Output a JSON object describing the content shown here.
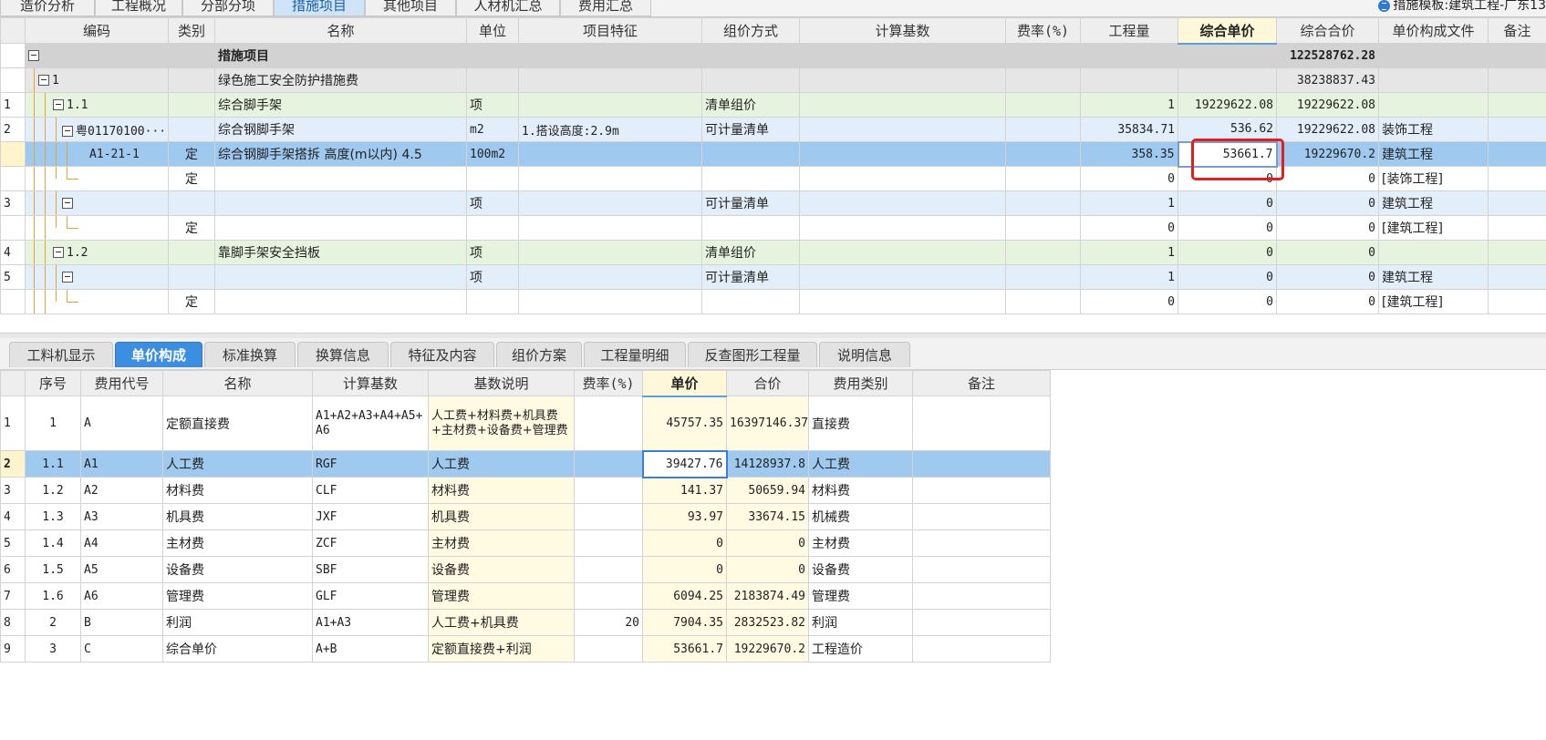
{
  "top_tabs": [
    {
      "label": "造价分析"
    },
    {
      "label": "工程概况"
    },
    {
      "label": "分部分项"
    },
    {
      "label": "措施项目"
    },
    {
      "label": "其他项目"
    },
    {
      "label": "人材机汇总"
    },
    {
      "label": "费用汇总"
    }
  ],
  "template_label": "措施模板:建筑工程-广东13",
  "upper_headers": [
    "",
    "编码",
    "类别",
    "名称",
    "单位",
    "项目特征",
    "组价方式",
    "计算基数",
    "费率(%)",
    "工程量",
    "综合单价",
    "综合合价",
    "单价构成文件",
    "备注"
  ],
  "upper_rows": [
    {
      "rownum": "",
      "code": "",
      "type": "",
      "name": "措施项目",
      "unit": "",
      "feature": "",
      "method": "",
      "base": "",
      "rate": "",
      "qty": "",
      "price": "",
      "total": "122528762.28",
      "file": "",
      "note": ""
    },
    {
      "rownum": "",
      "code": "1",
      "type": "",
      "name": "绿色施工安全防护措施费",
      "unit": "",
      "feature": "",
      "method": "",
      "base": "",
      "rate": "",
      "qty": "",
      "price": "",
      "total": "38238837.43",
      "file": "",
      "note": ""
    },
    {
      "rownum": "1",
      "code": "1.1",
      "type": "",
      "name": "综合脚手架",
      "unit": "项",
      "feature": "",
      "method": "清单组价",
      "base": "",
      "rate": "",
      "qty": "1",
      "price": "19229622.08",
      "total": "19229622.08",
      "file": "",
      "note": ""
    },
    {
      "rownum": "2",
      "code": "粤01170100···",
      "type": "",
      "name": "综合钢脚手架",
      "unit": "m2",
      "feature": "1.搭设高度:2.9m",
      "method": "可计量清单",
      "base": "",
      "rate": "",
      "qty": "35834.71",
      "price": "536.62",
      "total": "19229622.08",
      "file": "装饰工程",
      "note": ""
    },
    {
      "rownum": "",
      "code": "A1-21-1",
      "type": "定",
      "name": "综合钢脚手架搭拆 高度(m以内) 4.5",
      "unit": "100m2",
      "feature": "",
      "method": "",
      "base": "",
      "rate": "",
      "qty": "358.35",
      "price": "53661.7",
      "total": "19229670.2",
      "file": "建筑工程",
      "note": ""
    },
    {
      "rownum": "",
      "code": "",
      "type": "定",
      "name": "",
      "unit": "",
      "feature": "",
      "method": "",
      "base": "",
      "rate": "",
      "qty": "0",
      "price": "0",
      "total": "0",
      "file": "[装饰工程]",
      "note": ""
    },
    {
      "rownum": "3",
      "code": "",
      "type": "",
      "name": "",
      "unit": "项",
      "feature": "",
      "method": "可计量清单",
      "base": "",
      "rate": "",
      "qty": "1",
      "price": "0",
      "total": "0",
      "file": "建筑工程",
      "note": ""
    },
    {
      "rownum": "",
      "code": "",
      "type": "定",
      "name": "",
      "unit": "",
      "feature": "",
      "method": "",
      "base": "",
      "rate": "",
      "qty": "0",
      "price": "0",
      "total": "0",
      "file": "[建筑工程]",
      "note": ""
    },
    {
      "rownum": "4",
      "code": "1.2",
      "type": "",
      "name": "靠脚手架安全挡板",
      "unit": "项",
      "feature": "",
      "method": "清单组价",
      "base": "",
      "rate": "",
      "qty": "1",
      "price": "0",
      "total": "0",
      "file": "",
      "note": ""
    },
    {
      "rownum": "5",
      "code": "",
      "type": "",
      "name": "",
      "unit": "项",
      "feature": "",
      "method": "可计量清单",
      "base": "",
      "rate": "",
      "qty": "1",
      "price": "0",
      "total": "0",
      "file": "建筑工程",
      "note": ""
    },
    {
      "rownum": "",
      "code": "",
      "type": "定",
      "name": "",
      "unit": "",
      "feature": "",
      "method": "",
      "base": "",
      "rate": "",
      "qty": "0",
      "price": "0",
      "total": "0",
      "file": "[建筑工程]",
      "note": ""
    }
  ],
  "bottom_tabs": [
    {
      "label": "工料机显示"
    },
    {
      "label": "单价构成"
    },
    {
      "label": "标准换算"
    },
    {
      "label": "换算信息"
    },
    {
      "label": "特征及内容"
    },
    {
      "label": "组价方案"
    },
    {
      "label": "工程量明细"
    },
    {
      "label": "反查图形工程量"
    },
    {
      "label": "说明信息"
    }
  ],
  "lower_headers": [
    "",
    "序号",
    "费用代号",
    "名称",
    "计算基数",
    "基数说明",
    "费率(%)",
    "单价",
    "合价",
    "费用类别",
    "备注"
  ],
  "lower_rows": [
    {
      "rownum": "1",
      "seq": "1",
      "code": "A",
      "name": "定额直接费",
      "base": "A1+A2+A3+A4+A5+A6",
      "desc": "人工费+材料费+机具费+主材费+设备费+管理费",
      "rate": "",
      "price": "45757.35",
      "total": "16397146.37",
      "cat": "直接费",
      "note": ""
    },
    {
      "rownum": "2",
      "seq": "1.1",
      "code": "A1",
      "name": "人工费",
      "base": "RGF",
      "desc": "人工费",
      "rate": "",
      "price": "39427.76",
      "total": "14128937.8",
      "cat": "人工费",
      "note": ""
    },
    {
      "rownum": "3",
      "seq": "1.2",
      "code": "A2",
      "name": "材料费",
      "base": "CLF",
      "desc": "材料费",
      "rate": "",
      "price": "141.37",
      "total": "50659.94",
      "cat": "材料费",
      "note": ""
    },
    {
      "rownum": "4",
      "seq": "1.3",
      "code": "A3",
      "name": "机具费",
      "base": "JXF",
      "desc": "机具费",
      "rate": "",
      "price": "93.97",
      "total": "33674.15",
      "cat": "机械费",
      "note": ""
    },
    {
      "rownum": "5",
      "seq": "1.4",
      "code": "A4",
      "name": "主材费",
      "base": "ZCF",
      "desc": "主材费",
      "rate": "",
      "price": "0",
      "total": "0",
      "cat": "主材费",
      "note": ""
    },
    {
      "rownum": "6",
      "seq": "1.5",
      "code": "A5",
      "name": "设备费",
      "base": "SBF",
      "desc": "设备费",
      "rate": "",
      "price": "0",
      "total": "0",
      "cat": "设备费",
      "note": ""
    },
    {
      "rownum": "7",
      "seq": "1.6",
      "code": "A6",
      "name": "管理费",
      "base": "GLF",
      "desc": "管理费",
      "rate": "",
      "price": "6094.25",
      "total": "2183874.49",
      "cat": "管理费",
      "note": ""
    },
    {
      "rownum": "8",
      "seq": "2",
      "code": "B",
      "name": "利润",
      "base": "A1+A3",
      "desc": "人工费+机具费",
      "rate": "20",
      "price": "7904.35",
      "total": "2832523.82",
      "cat": "利润",
      "note": ""
    },
    {
      "rownum": "9",
      "seq": "3",
      "code": "C",
      "name": "综合单价",
      "base": "A+B",
      "desc": "定额直接费+利润",
      "rate": "",
      "price": "53661.7",
      "total": "19229670.2",
      "cat": "工程造价",
      "note": ""
    }
  ]
}
